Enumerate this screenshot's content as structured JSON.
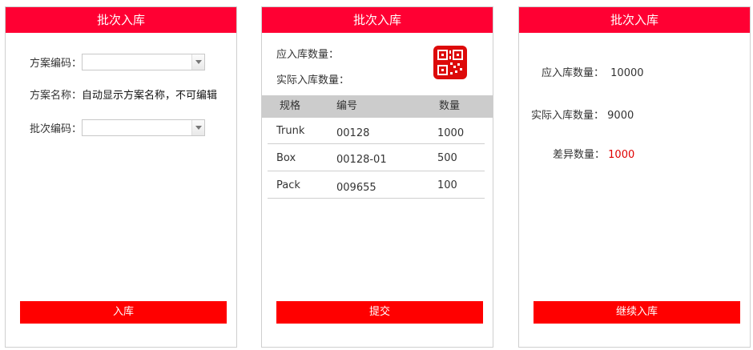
{
  "panel1": {
    "title": "批次入库",
    "scheme_code_label": "方案编码：",
    "scheme_name_label": "方案名称：",
    "scheme_name_value": "自动显示方案名称，不可编辑",
    "batch_code_label": "批次编码：",
    "button": "入库"
  },
  "panel2": {
    "title": "批次入库",
    "expected_label": "应入库数量：",
    "actual_label": "实际入库数量：",
    "columns": [
      "规格",
      "编号",
      "数量"
    ],
    "rows": [
      {
        "spec": "Trunk",
        "code": "00128",
        "qty": "1000"
      },
      {
        "spec": "Box",
        "code": "00128-01",
        "qty": "500"
      },
      {
        "spec": "Pack",
        "code": "009655",
        "qty": "100"
      }
    ],
    "button": "提交"
  },
  "panel3": {
    "title": "批次入库",
    "expected_label": "应入库数量：",
    "expected_value": "10000",
    "actual_label": "实际入库数量：",
    "actual_value": "9000",
    "diff_label": "差异数量：",
    "diff_value": "1000",
    "button": "继续入库"
  },
  "colors": {
    "header": "#ff0033",
    "button": "#ff0000",
    "diff": "#e00000"
  },
  "icons": {
    "qr": "qr-code-icon",
    "dropdown": "chevron-down-icon"
  }
}
